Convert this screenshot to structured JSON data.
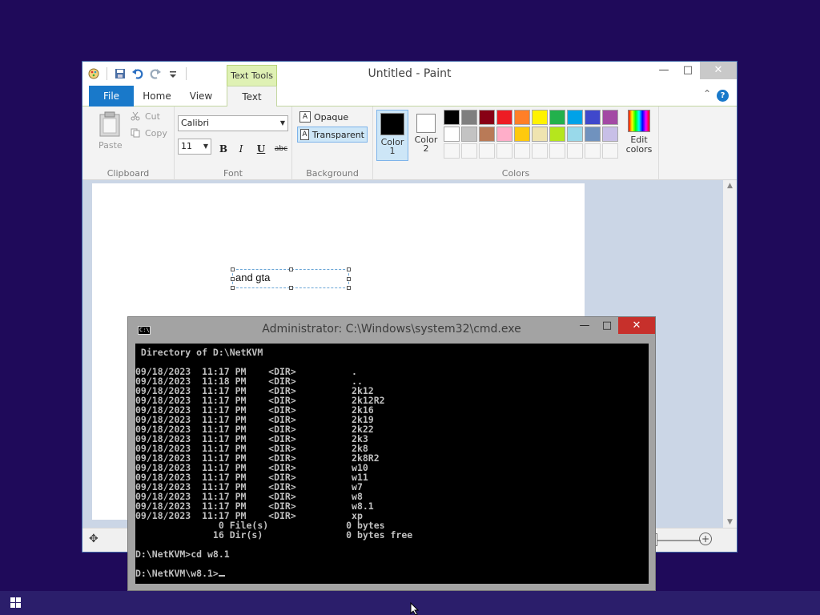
{
  "paint": {
    "title": "Untitled - Paint",
    "context_tab": "Text Tools",
    "tabs": {
      "file": "File",
      "home": "Home",
      "view": "View",
      "text": "Text"
    },
    "clipboard": {
      "paste": "Paste",
      "cut": "Cut",
      "copy": "Copy",
      "label": "Clipboard"
    },
    "font": {
      "family": "Calibri",
      "size": "11",
      "bold": "B",
      "italic": "I",
      "underline": "U",
      "strike": "abc",
      "label": "Font"
    },
    "background": {
      "opaque": "Opaque",
      "transparent": "Transparent",
      "label": "Background",
      "selected": "transparent"
    },
    "colors": {
      "color1_label_a": "Color",
      "color1_label_b": "1",
      "color2_label_a": "Color",
      "color2_label_b": "2",
      "color1": "#000000",
      "color2": "#ffffff",
      "edit_a": "Edit",
      "edit_b": "colors",
      "label": "Colors",
      "palette_row1": [
        "#000000",
        "#7f7f7f",
        "#880015",
        "#ed1c24",
        "#ff7f27",
        "#fff200",
        "#22b14c",
        "#00a2e8",
        "#3f48cc",
        "#a349a4"
      ],
      "palette_row2": [
        "#ffffff",
        "#c3c3c3",
        "#b97a57",
        "#ffaec9",
        "#ffc90e",
        "#efe4b0",
        "#b5e61d",
        "#99d9ea",
        "#7092be",
        "#c8bfe7"
      ]
    },
    "canvas_text": "and gta"
  },
  "cmd": {
    "title": "Administrator: C:\\Windows\\system32\\cmd.exe",
    "icon_text": "C:\\",
    "lines": [
      " Directory of D:\\NetKVM",
      "",
      "09/18/2023  11:17 PM    <DIR>          .",
      "09/18/2023  11:18 PM    <DIR>          ..",
      "09/18/2023  11:17 PM    <DIR>          2k12",
      "09/18/2023  11:17 PM    <DIR>          2k12R2",
      "09/18/2023  11:17 PM    <DIR>          2k16",
      "09/18/2023  11:17 PM    <DIR>          2k19",
      "09/18/2023  11:17 PM    <DIR>          2k22",
      "09/18/2023  11:17 PM    <DIR>          2k3",
      "09/18/2023  11:17 PM    <DIR>          2k8",
      "09/18/2023  11:17 PM    <DIR>          2k8R2",
      "09/18/2023  11:17 PM    <DIR>          w10",
      "09/18/2023  11:17 PM    <DIR>          w11",
      "09/18/2023  11:17 PM    <DIR>          w7",
      "09/18/2023  11:17 PM    <DIR>          w8",
      "09/18/2023  11:17 PM    <DIR>          w8.1",
      "09/18/2023  11:17 PM    <DIR>          xp",
      "               0 File(s)              0 bytes",
      "              16 Dir(s)               0 bytes free",
      "",
      "D:\\NetKVM>cd w8.1",
      ""
    ],
    "prompt": "D:\\NetKVM\\w8.1>"
  },
  "taskbar": {
    "start_icon": "windows-logo-icon"
  }
}
